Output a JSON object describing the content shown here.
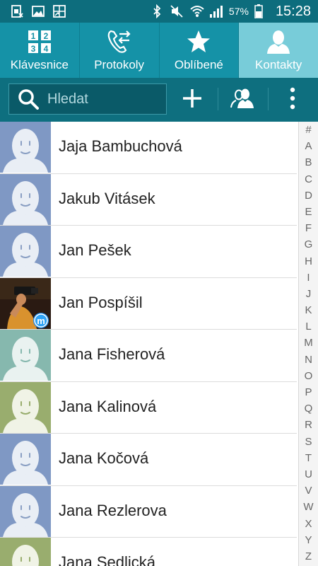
{
  "status_bar": {
    "battery_percent": "57%",
    "time": "15:28",
    "icons": [
      "sim-icon",
      "image-icon",
      "screenshot-icon",
      "bluetooth-icon",
      "mute-icon",
      "wifi-icon",
      "signal-icon",
      "battery-icon"
    ]
  },
  "tabs": [
    {
      "label": "Klávesnice",
      "icon": "keypad-icon",
      "active": false
    },
    {
      "label": "Protokoly",
      "icon": "call-log-icon",
      "active": false
    },
    {
      "label": "Oblíbené",
      "icon": "star-icon",
      "active": false
    },
    {
      "label": "Kontakty",
      "icon": "contact-icon",
      "active": true
    }
  ],
  "toolbar": {
    "search_placeholder": "Hledat",
    "search_value": "",
    "buttons": [
      "add-icon",
      "group-icon",
      "more-icon"
    ]
  },
  "contacts": [
    {
      "name": "Jaja Bambuchová",
      "avatar_color": "#7f98c4"
    },
    {
      "name": "Jakub Vitásek",
      "avatar_color": "#7f98c4"
    },
    {
      "name": "Jan Pešek",
      "avatar_color": "#7f98c4"
    },
    {
      "name": "Jan Pospíšil",
      "avatar_color": "photo"
    },
    {
      "name": "Jana Fisherová",
      "avatar_color": "#86b8ae"
    },
    {
      "name": "Jana Kalinová",
      "avatar_color": "#99ad6e"
    },
    {
      "name": "Jana Kočová",
      "avatar_color": "#7f98c4"
    },
    {
      "name": "Jana Rezlerova",
      "avatar_color": "#7f98c4"
    },
    {
      "name": "Jana Sedlická",
      "avatar_color": "#99ad6e"
    }
  ],
  "index_letters": [
    "#",
    "A",
    "B",
    "C",
    "D",
    "E",
    "F",
    "G",
    "H",
    "I",
    "J",
    "K",
    "L",
    "M",
    "N",
    "O",
    "P",
    "Q",
    "R",
    "S",
    "T",
    "U",
    "V",
    "W",
    "X",
    "Y",
    "Z"
  ],
  "colors": {
    "status_bar": "#0d6d7d",
    "tab_bar": "#1592a7",
    "tab_active": "#78ccd9",
    "toolbar": "#0e6f7f"
  }
}
